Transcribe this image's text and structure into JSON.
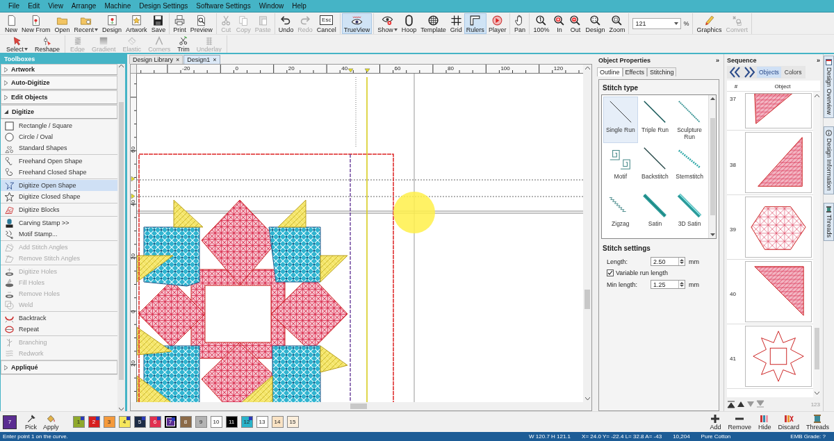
{
  "menu": [
    "File",
    "Edit",
    "View",
    "Arrange",
    "Machine",
    "Design Settings",
    "Software Settings",
    "Window",
    "Help"
  ],
  "toolbar": {
    "groups": [
      [
        {
          "label": "New",
          "disabled": false,
          "active": false,
          "dropdown": false
        },
        {
          "label": "New From",
          "disabled": false,
          "active": false,
          "dropdown": false
        },
        {
          "label": "Open",
          "disabled": false,
          "active": false,
          "dropdown": false
        },
        {
          "label": "Recent",
          "disabled": false,
          "active": false,
          "dropdown": true
        },
        {
          "label": "Design",
          "disabled": false,
          "active": false,
          "dropdown": false
        },
        {
          "label": "Artwork",
          "disabled": false,
          "active": false,
          "dropdown": false
        },
        {
          "label": "Save",
          "disabled": false,
          "active": false,
          "dropdown": false
        }
      ],
      [
        {
          "label": "Print",
          "disabled": false,
          "active": false,
          "dropdown": false
        },
        {
          "label": "Preview",
          "disabled": false,
          "active": false,
          "dropdown": false
        }
      ],
      [
        {
          "label": "Cut",
          "disabled": true,
          "active": false,
          "dropdown": false
        },
        {
          "label": "Copy",
          "disabled": true,
          "active": false,
          "dropdown": false
        },
        {
          "label": "Paste",
          "disabled": true,
          "active": false,
          "dropdown": false
        }
      ],
      [
        {
          "label": "Undo",
          "disabled": false,
          "active": false,
          "dropdown": false
        },
        {
          "label": "Redo",
          "disabled": true,
          "active": false,
          "dropdown": false
        },
        {
          "label": "Cancel",
          "key": "Esc",
          "disabled": false,
          "active": false,
          "dropdown": false
        }
      ],
      [
        {
          "label": "TrueView",
          "disabled": false,
          "active": true,
          "dropdown": false
        }
      ],
      [
        {
          "label": "Show",
          "disabled": false,
          "active": false,
          "dropdown": true
        },
        {
          "label": "Hoop",
          "disabled": false,
          "active": false,
          "dropdown": false
        },
        {
          "label": "Template",
          "disabled": false,
          "active": false,
          "dropdown": false
        },
        {
          "label": "Grid",
          "disabled": false,
          "active": false,
          "dropdown": false
        },
        {
          "label": "Rulers",
          "disabled": false,
          "active": true,
          "dropdown": false
        },
        {
          "label": "Player",
          "disabled": false,
          "active": false,
          "dropdown": false
        }
      ],
      [
        {
          "label": "Pan",
          "disabled": false,
          "active": false,
          "dropdown": false
        }
      ],
      [
        {
          "label": "100%",
          "disabled": false,
          "active": false,
          "dropdown": false
        },
        {
          "label": "In",
          "disabled": false,
          "active": false,
          "dropdown": false
        },
        {
          "label": "Out",
          "disabled": false,
          "active": false,
          "dropdown": false
        },
        {
          "label": "Design",
          "disabled": false,
          "active": false,
          "dropdown": false
        },
        {
          "label": "Zoom",
          "disabled": false,
          "active": false,
          "dropdown": false
        }
      ]
    ],
    "zoom_field": {
      "value": "121",
      "unit": "%"
    },
    "end_groups": [
      [
        {
          "label": "Graphics",
          "disabled": false,
          "active": false,
          "dropdown": false
        },
        {
          "label": "Convert",
          "disabled": true,
          "active": false,
          "dropdown": false
        }
      ]
    ]
  },
  "tool_row": {
    "groups": [
      [
        {
          "label": "Select",
          "disabled": false,
          "dropdown": true
        },
        {
          "label": "Reshape",
          "disabled": false,
          "dropdown": false
        }
      ],
      [
        {
          "label": "Edge",
          "disabled": true,
          "dropdown": false
        },
        {
          "label": "Gradient",
          "disabled": true,
          "dropdown": false
        },
        {
          "label": "Elastic",
          "disabled": true,
          "dropdown": false
        },
        {
          "label": "Corners",
          "disabled": true,
          "dropdown": false
        },
        {
          "label": "Trim",
          "disabled": false,
          "dropdown": false
        },
        {
          "label": "Underlay",
          "disabled": true,
          "dropdown": false
        }
      ]
    ]
  },
  "toolbox": {
    "title": "Toolboxes",
    "sections": [
      {
        "label": "Artwork",
        "expanded": false
      },
      {
        "label": "Auto-Digitize",
        "expanded": false
      },
      {
        "label": "Edit Objects",
        "expanded": false
      },
      {
        "label": "Digitize",
        "expanded": true,
        "groups": [
          [
            {
              "label": "Rectangle / Square",
              "disabled": false,
              "selected": false
            },
            {
              "label": "Circle / Oval",
              "disabled": false,
              "selected": false
            },
            {
              "label": "Standard Shapes",
              "disabled": false,
              "selected": false
            }
          ],
          [
            {
              "label": "Freehand Open Shape",
              "disabled": false,
              "selected": false
            },
            {
              "label": "Freehand Closed Shape",
              "disabled": false,
              "selected": false
            }
          ],
          [
            {
              "label": "Digitize Open Shape",
              "disabled": false,
              "selected": true
            },
            {
              "label": "Digitize Closed Shape",
              "disabled": false,
              "selected": false
            }
          ],
          [
            {
              "label": "Digitize Blocks",
              "disabled": false,
              "selected": false
            }
          ],
          [
            {
              "label": "Carving Stamp >>",
              "disabled": false,
              "selected": false
            },
            {
              "label": "Motif Stamp...",
              "disabled": false,
              "selected": false
            }
          ],
          [
            {
              "label": "Add Stitch Angles",
              "disabled": true,
              "selected": false
            },
            {
              "label": "Remove Stitch Angles",
              "disabled": true,
              "selected": false
            }
          ],
          [
            {
              "label": "Digitize Holes",
              "disabled": true,
              "selected": false
            },
            {
              "label": "Fill Holes",
              "disabled": true,
              "selected": false
            },
            {
              "label": "Remove Holes",
              "disabled": true,
              "selected": false
            },
            {
              "label": "Weld",
              "disabled": true,
              "selected": false
            }
          ],
          [
            {
              "label": "Backtrack",
              "disabled": false,
              "selected": false
            },
            {
              "label": "Repeat",
              "disabled": false,
              "selected": false
            }
          ],
          [
            {
              "label": "Branching",
              "disabled": true,
              "selected": false
            },
            {
              "label": "Redwork",
              "disabled": true,
              "selected": false
            }
          ]
        ]
      },
      {
        "label": "Appliqué",
        "expanded": false
      }
    ]
  },
  "document_tabs": [
    {
      "label": "Design Library",
      "selected": false,
      "close": "×"
    },
    {
      "label": "Design1",
      "selected": true,
      "close": "×"
    }
  ],
  "rulers": {
    "horizontal": [
      "-20",
      "0",
      "20",
      "40",
      "60",
      "80",
      "100",
      "120"
    ],
    "vertical": [
      "60",
      "40",
      "20",
      "0",
      "20"
    ]
  },
  "object_properties": {
    "title": "Object Properties",
    "collapse": "»",
    "tabs": [
      {
        "label": "Outline",
        "selected": true
      },
      {
        "label": "Effects",
        "selected": false
      },
      {
        "label": "Stitching",
        "selected": false
      }
    ],
    "stitch_type_heading": "Stitch type",
    "stitch_types": [
      {
        "label": "Single Run",
        "selected": true
      },
      {
        "label": "Triple Run",
        "selected": false
      },
      {
        "label": "Sculpture Run",
        "selected": false
      },
      {
        "label": "Motif",
        "selected": false
      },
      {
        "label": "Backstitch",
        "selected": false
      },
      {
        "label": "Stemstitch",
        "selected": false
      },
      {
        "label": "Zigzag",
        "selected": false
      },
      {
        "label": "Satin",
        "selected": false
      },
      {
        "label": "3D Satin",
        "selected": false
      }
    ],
    "stitch_settings_heading": "Stitch settings",
    "length": {
      "label": "Length:",
      "value": "2.50",
      "unit": "mm"
    },
    "variable_run_length": {
      "label": "Variable run length",
      "checked": true
    },
    "min_length": {
      "label": "Min length:",
      "value": "1.25",
      "unit": "mm"
    }
  },
  "sequence": {
    "title": "Sequence",
    "collapse": "»",
    "tabs": [
      {
        "label": "Objects",
        "selected": true
      },
      {
        "label": "Colors",
        "selected": false
      }
    ],
    "columns": [
      "#",
      "Object"
    ],
    "rows": [
      {
        "number": "37"
      },
      {
        "number": "38"
      },
      {
        "number": "39"
      },
      {
        "number": "40"
      },
      {
        "number": "41"
      }
    ],
    "footer_badge": "123"
  },
  "side_tabs": [
    "Design Overview",
    "Design Information",
    "Threads"
  ],
  "palette": {
    "current": {
      "number": "7",
      "color": "#5b2d91"
    },
    "tools": [
      "Pick",
      "Apply"
    ],
    "colors": [
      {
        "number": "1",
        "color": "#8fa92b",
        "selected": false,
        "marked": true
      },
      {
        "number": "2",
        "color": "#d7201f",
        "selected": false,
        "marked": true
      },
      {
        "number": "3",
        "color": "#f59a3c",
        "selected": false,
        "marked": false
      },
      {
        "number": "4",
        "color": "#f6e65c",
        "selected": false,
        "marked": true
      },
      {
        "number": "5",
        "color": "#1c2b45",
        "selected": false,
        "marked": true
      },
      {
        "number": "6",
        "color": "#e1304f",
        "selected": false,
        "marked": true
      },
      {
        "number": "7",
        "color": "#5b2d91",
        "selected": true,
        "marked": true
      },
      {
        "number": "8",
        "color": "#8b6a48",
        "selected": false,
        "marked": false
      },
      {
        "number": "9",
        "color": "#b3b3b3",
        "selected": false,
        "marked": false
      },
      {
        "number": "10",
        "color": "#ffffff",
        "selected": false,
        "marked": false
      },
      {
        "number": "11",
        "color": "#000000",
        "selected": false,
        "marked": false
      },
      {
        "number": "12",
        "color": "#2ab3c9",
        "selected": false,
        "marked": true
      },
      {
        "number": "13",
        "color": "#ffffff",
        "selected": false,
        "marked": false
      },
      {
        "number": "14",
        "color": "#fae3c4",
        "selected": false,
        "marked": false
      },
      {
        "number": "15",
        "color": "#fbeedb",
        "selected": false,
        "marked": false
      }
    ],
    "actions": [
      "Add",
      "Remove",
      "Hide",
      "Discard",
      "Threads"
    ]
  },
  "status_bar": {
    "prompt": "Enter point 1 on the curve.",
    "size": "W 120.7 H 121.1",
    "coordinates": "X= 24.0 Y= -22.4 L= 32.8 A= -43",
    "stitch_count": "10,204",
    "thread": "Pure Cotton",
    "grade": "EMB Grade: ?"
  }
}
